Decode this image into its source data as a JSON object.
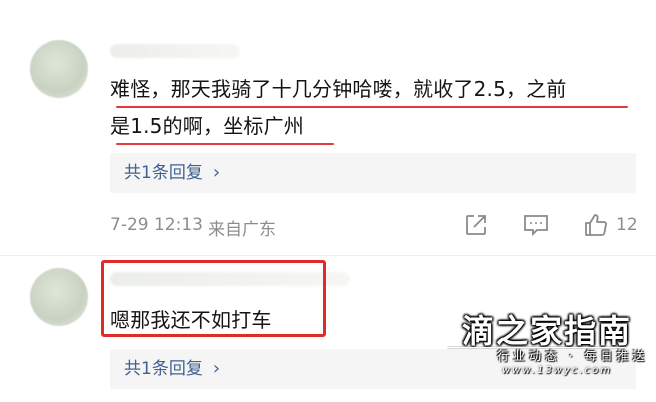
{
  "comment1": {
    "line1": "难怪，那天我骑了十几分钟哈喽，就收了2.5，之前",
    "line2": "是1.5的啊，坐标广州",
    "replies_label": "共1条回复",
    "chevron": "›",
    "date": "7-29 12:13",
    "location": "来自广东",
    "like_count": "12",
    "icons": [
      "share-icon",
      "comment-icon",
      "thumbs-up-icon"
    ]
  },
  "comment2": {
    "text": "嗯那我还不如打车",
    "replies_label": "共1条回复",
    "chevron": "›"
  },
  "watermark": {
    "title": "滴之家指南",
    "subtitle": "行业动态 · 每日推送",
    "url": "www.13wyc.com"
  },
  "colors": {
    "link": "#3f6292",
    "highlight_red": "#e03a3a",
    "meta_gray": "#8d8d8d",
    "reply_bg": "#f5f5f5"
  }
}
